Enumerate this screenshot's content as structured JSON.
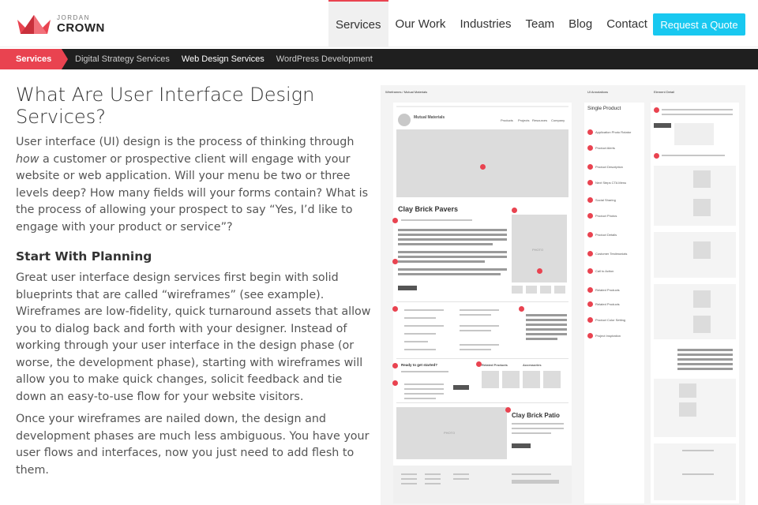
{
  "header": {
    "logo_small": "JORDAN",
    "logo_big": "CROWN",
    "nav": [
      "Services",
      "Our Work",
      "Industries",
      "Team",
      "Blog",
      "Contact"
    ],
    "active_nav": "Services",
    "cta": "Request a Quote"
  },
  "subnav": {
    "active": "Services",
    "items": [
      "Digital Strategy Services",
      "Web Design Services",
      "WordPress Development"
    ],
    "current": "Web Design Services"
  },
  "article": {
    "title": "What Are User Interface Design Services?",
    "p1_before": "User interface (UI) design is the process of thinking through ",
    "p1_em": "how",
    "p1_after": " a customer or prospective client will engage with your website or web application. Will your menu be two or three levels deep? How many fields will your forms contain? What is the process of allowing your prospect to say “Yes, I’d like to engage with your product or service”?",
    "h_planning": "Start With Planning",
    "p2": "Great user interface design services first begin with solid blueprints that are called “wireframes” (see example). Wireframes are low-fidelity, quick turnaround assets that allow you to dialog back and forth with your designer. Instead of working through your user interface in the design phase (or worse, the development phase), starting with wireframes will allow you to make quick changes, solicit feedback and tie down an easy-to-use flow for your website visitors.",
    "p3": "Once your wireframes are nailed down, the design and development phases are much less ambiguous. You have your user flows and interfaces, now you just need to add flesh to them."
  },
  "wireframe": {
    "header_label": "Wireframes / Mutual Materials",
    "company": "Mutual Materials",
    "menu": [
      "Products",
      "Projects",
      "Resources",
      "Company"
    ],
    "product_title": "Clay Brick Pavers",
    "photo_label": "PHOTO",
    "ready_heading": "Ready to get started?",
    "related_products": "Related Products",
    "accessories": "Accessories",
    "patio_title": "Clay Brick Patio",
    "annotations_title": "UI Annotations",
    "single_product": "Single Product",
    "element_detail": "Element Detail",
    "annotation_items": [
      "Application Photo Rotator",
      "Product Alerts",
      "Product Description",
      "Next Steps CTA Menu",
      "Social Sharing",
      "Product Photos",
      "Product Details",
      "Customer Testimonials",
      "Call to Action",
      "Related Products",
      "Related Products",
      "Product Color Setting",
      "Project Inspiration"
    ],
    "colors": {
      "accent": "#e94350"
    }
  },
  "colors": {
    "accent": "#e94350",
    "cta": "#18c8f0",
    "subnav_bg": "#1f1f1f"
  }
}
